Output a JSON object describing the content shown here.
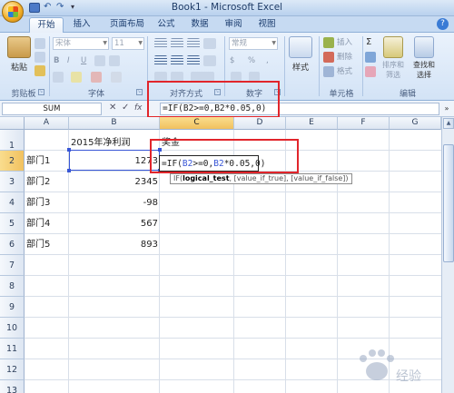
{
  "window": {
    "title": "Book1 - Microsoft Excel"
  },
  "ribbon_tabs": [
    "开始",
    "插入",
    "页面布局",
    "公式",
    "数据",
    "审阅",
    "视图"
  ],
  "ribbon": {
    "clipboard": {
      "paste_label": "粘贴",
      "group_label": "剪贴板"
    },
    "font": {
      "font_name": "宋体",
      "font_size": "11",
      "group_label": "字体"
    },
    "alignment": {
      "group_label": "对齐方式"
    },
    "number": {
      "format": "常规",
      "group_label": "数字"
    },
    "styles": {
      "label": "样式"
    },
    "cells": {
      "insert": "插入",
      "delete": "删除",
      "format": "格式",
      "group_label": "单元格"
    },
    "editing": {
      "sort_filter": "排序和\n筛选",
      "find_select": "查找和\n选择",
      "group_label": "编辑"
    }
  },
  "formula_bar": {
    "name_box": "SUM",
    "formula": "=IF(B2>=0,B2*0.05,0)"
  },
  "grid": {
    "columns": [
      "A",
      "B",
      "C",
      "D",
      "E",
      "F",
      "G"
    ],
    "rows": [
      "1",
      "2",
      "3",
      "4",
      "5",
      "6",
      "7",
      "8",
      "9",
      "10",
      "11",
      "12",
      "13"
    ],
    "cells": {
      "B1": "2015年净利润",
      "C1": "奖金",
      "A2": "部门1",
      "B2": "1273",
      "A3": "部门2",
      "B3": "2345",
      "A4": "部门3",
      "B4": "-98",
      "A5": "部门4",
      "B5": "567",
      "A6": "部门5",
      "B6": "893"
    },
    "active_cell": "C2",
    "edit_text": {
      "prefix": "=IF(",
      "ref1": "B2",
      "mid": ">=0,",
      "ref2": "B2",
      "suffix": "*0.05,0)"
    },
    "tooltip": {
      "fn": "IF(",
      "arg1": "logical_test",
      "rest": ", [value_if_true], [value_if_false])"
    }
  },
  "colors": {
    "highlight": "#e1252b",
    "reference": "#3856d6",
    "ribbon": "#dbe7f6"
  },
  "watermark": "Baidu 经验"
}
